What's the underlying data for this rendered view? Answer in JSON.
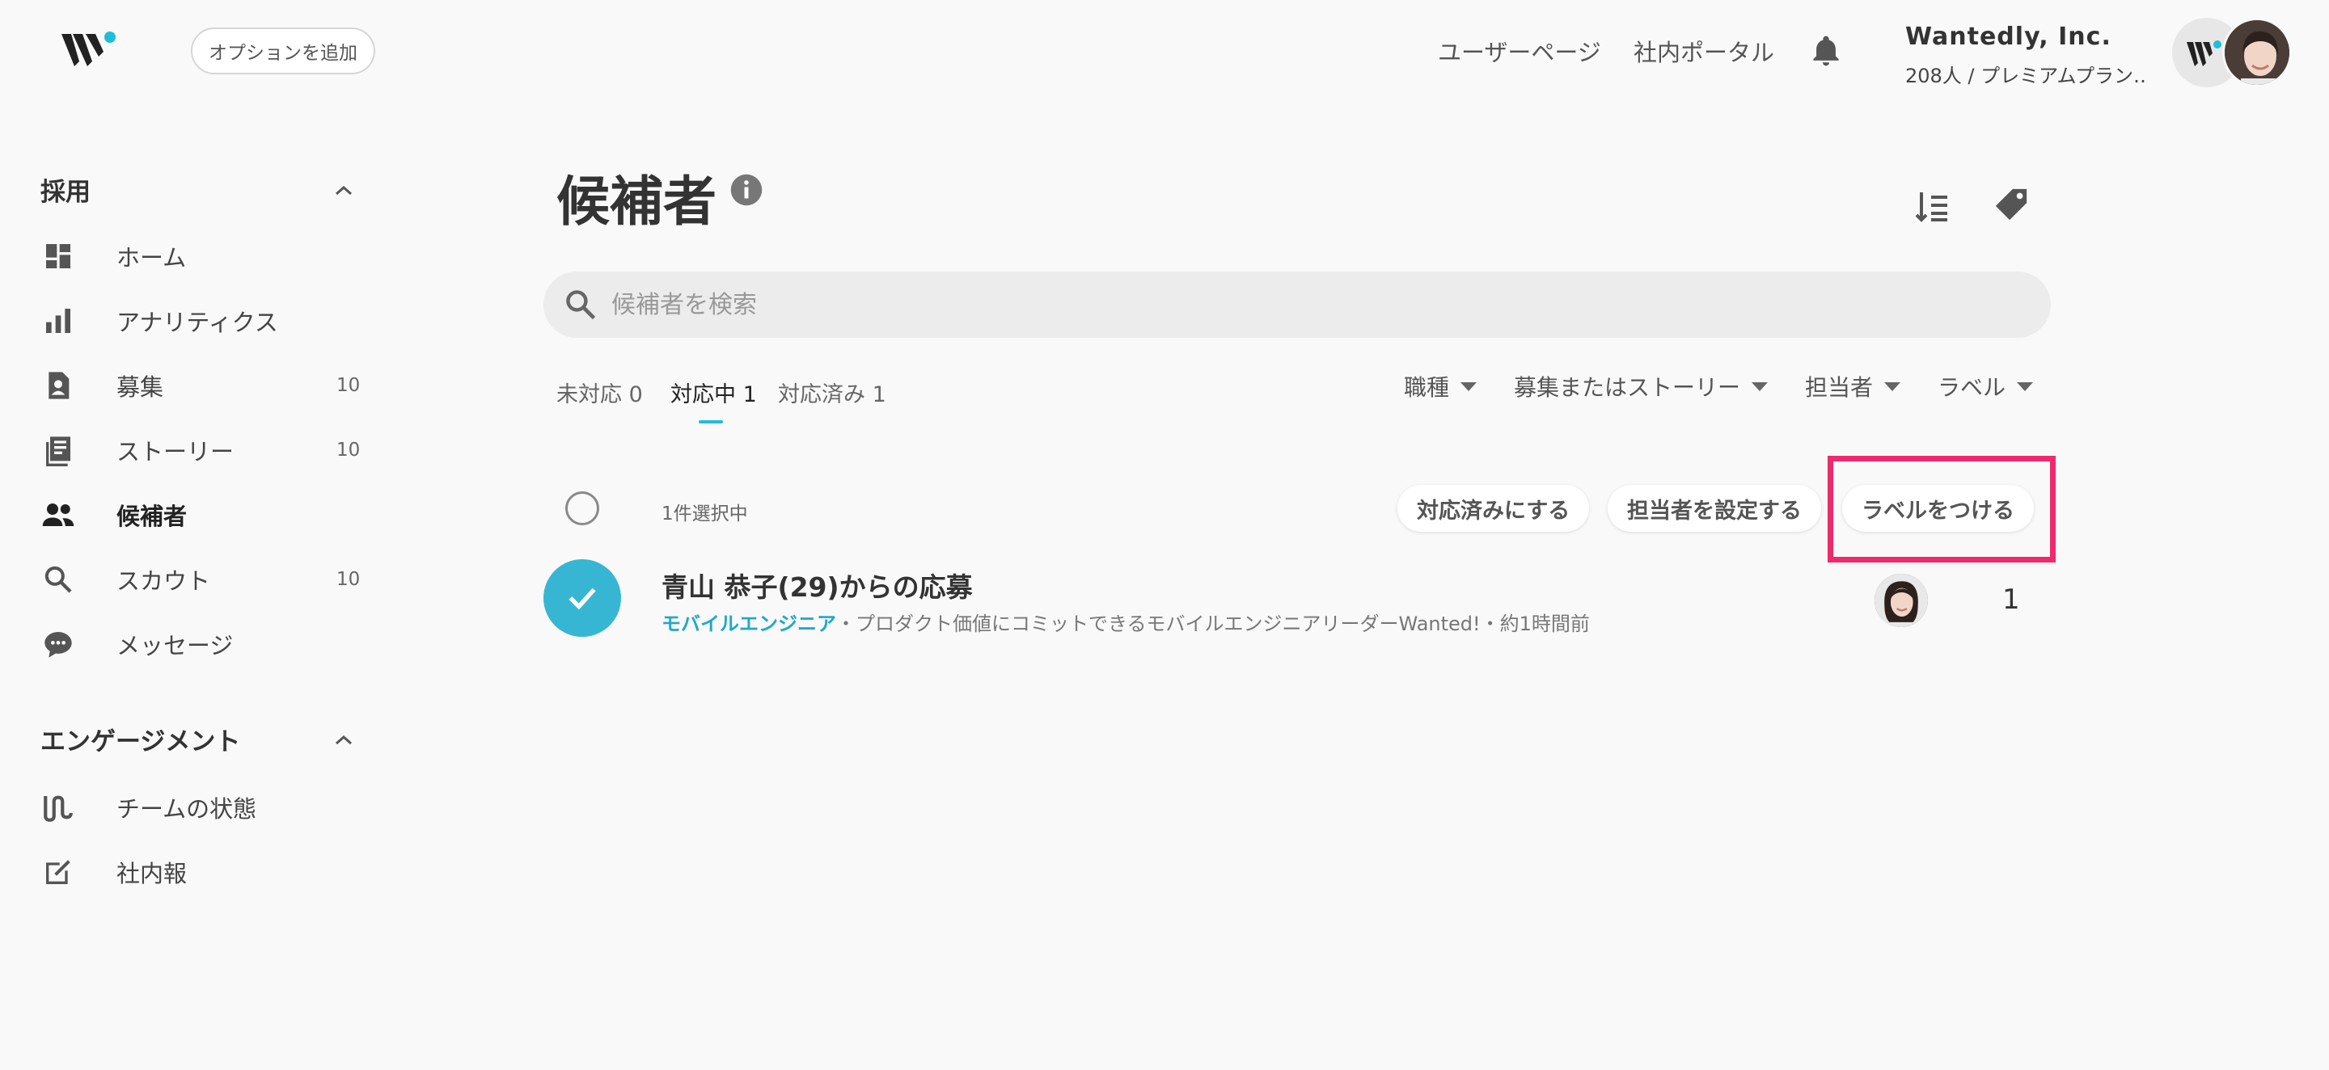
{
  "header": {
    "add_option": "オプションを追加",
    "user_page": "ユーザーページ",
    "portal": "社内ポータル",
    "company_name": "Wantedly, Inc.",
    "company_plan": "208人 / プレミアムプラン…"
  },
  "sidebar": {
    "sections": [
      {
        "title": "採用",
        "items": [
          {
            "label": "ホーム",
            "count": "",
            "icon": "dashboard-icon"
          },
          {
            "label": "アナリティクス",
            "count": "",
            "icon": "bar-chart-icon"
          },
          {
            "label": "募集",
            "count": "10",
            "icon": "job-post-icon"
          },
          {
            "label": "ストーリー",
            "count": "10",
            "icon": "story-icon"
          },
          {
            "label": "候補者",
            "count": "",
            "icon": "people-icon"
          },
          {
            "label": "スカウト",
            "count": "10",
            "icon": "search-icon"
          },
          {
            "label": "メッセージ",
            "count": "",
            "icon": "chat-icon"
          }
        ]
      },
      {
        "title": "エンゲージメント",
        "items": [
          {
            "label": "チームの状態",
            "count": "",
            "icon": "team-wave-icon"
          },
          {
            "label": "社内報",
            "count": "",
            "icon": "edit-note-icon"
          }
        ]
      }
    ]
  },
  "main": {
    "title": "候補者",
    "search_placeholder": "候補者を検索",
    "tabs": [
      {
        "label": "未対応 0"
      },
      {
        "label": "対応中 1"
      },
      {
        "label": "対応済み 1"
      }
    ],
    "filters": [
      {
        "label": "職種"
      },
      {
        "label": "募集またはストーリー"
      },
      {
        "label": "担当者"
      },
      {
        "label": "ラベル"
      }
    ],
    "selection_text": "1件選択中",
    "actions": {
      "mark_done": "対応済みにする",
      "assign": "担当者を設定する",
      "label": "ラベルをつける"
    },
    "candidate": {
      "title": "青山 恭子(29)からの応募",
      "job": "モバイルエンジニア",
      "detail": "・プロダクト価値にコミットできるモバイルエンジニアリーダーWanted!・約1時間前",
      "count": "1"
    }
  },
  "colors": {
    "accent": "#21bddb",
    "highlight": "#ee2a6d"
  }
}
